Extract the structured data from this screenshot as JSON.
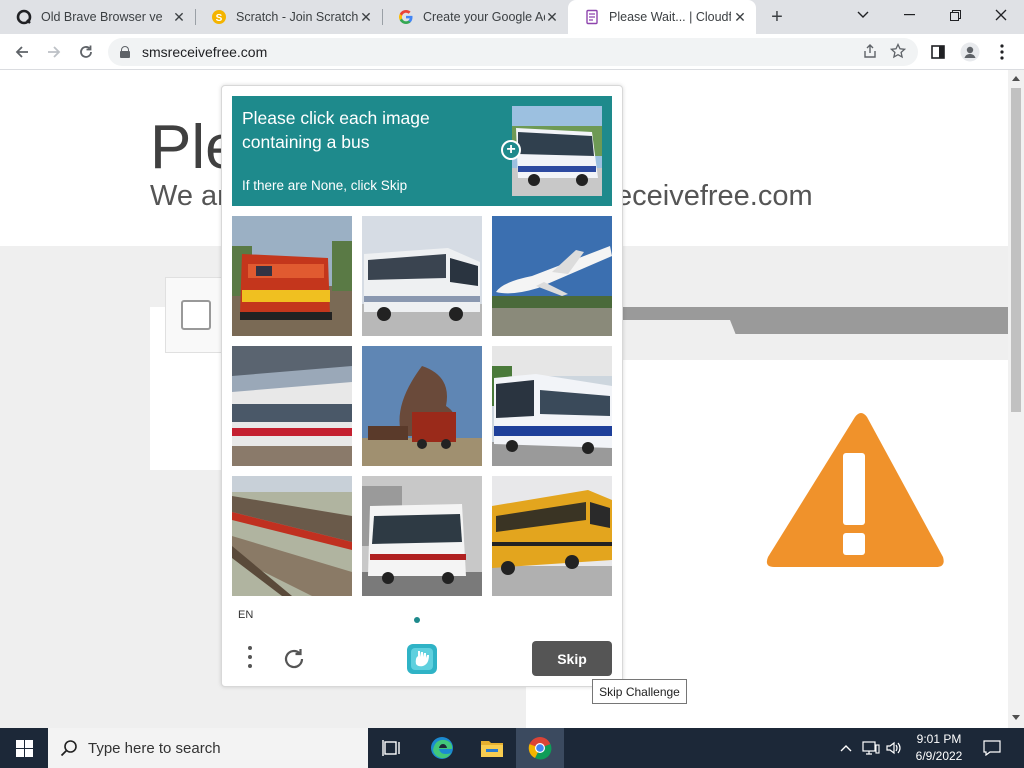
{
  "browser": {
    "tabs": [
      {
        "title": "Old Brave Browser vers",
        "favicon": "o-icon"
      },
      {
        "title": "Scratch - Join Scratch",
        "favicon": "scratch-icon"
      },
      {
        "title": "Create your Google Ac",
        "favicon": "google-icon"
      },
      {
        "title": "Please Wait... | Cloudfla",
        "favicon": "document-icon",
        "active": true
      }
    ],
    "new_tab": "+",
    "url": "smsreceivefree.com"
  },
  "page": {
    "heading_partial": "Ple",
    "subheading_left": "We ar",
    "subheading_right": "eceivefree.com"
  },
  "captcha": {
    "prompt_line1": "Please click each image",
    "prompt_line2": "containing a bus",
    "prompt_sub": "If there are None, click Skip",
    "language": "EN",
    "skip_label": "Skip",
    "tooltip": "Skip Challenge",
    "tiles": [
      {
        "subject": "train"
      },
      {
        "subject": "bus"
      },
      {
        "subject": "airplane"
      },
      {
        "subject": "train"
      },
      {
        "subject": "train"
      },
      {
        "subject": "bus"
      },
      {
        "subject": "train"
      },
      {
        "subject": "bus"
      },
      {
        "subject": "school-bus"
      }
    ]
  },
  "taskbar": {
    "search_placeholder": "Type here to search",
    "time": "9:01 PM",
    "date": "6/9/2022"
  },
  "colors": {
    "prompt_bg": "#1e8a8c",
    "warning": "#f0922b",
    "skip_bg": "#555555",
    "taskbar": "#1c2838"
  }
}
